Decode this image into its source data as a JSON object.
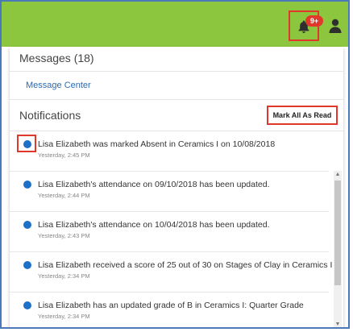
{
  "header": {
    "badge": "9+",
    "icons": [
      "bell-icon",
      "user-icon"
    ],
    "accent_color": "#8cc63f"
  },
  "messages": {
    "title": "Messages (18)",
    "center_link": "Message Center"
  },
  "notifications": {
    "title": "Notifications",
    "mark_all_label": "Mark All As Read",
    "items": [
      {
        "text": "Lisa Elizabeth was marked Absent in Ceramics I on 10/08/2018",
        "time": "Yesterday, 2:45 PM"
      },
      {
        "text": "Lisa Elizabeth's attendance on 09/10/2018 has been updated.",
        "time": "Yesterday, 2:44 PM"
      },
      {
        "text": "Lisa Elizabeth's attendance on 10/04/2018 has been updated.",
        "time": "Yesterday, 2:43 PM"
      },
      {
        "text": "Lisa Elizabeth received a score of 25 out of 30 on Stages of Clay in Ceramics I",
        "time": "Yesterday, 2:34 PM"
      },
      {
        "text": "Lisa Elizabeth has an updated grade of B in Ceramics I: Quarter Grade",
        "time": "Yesterday, 2:34 PM"
      }
    ]
  }
}
